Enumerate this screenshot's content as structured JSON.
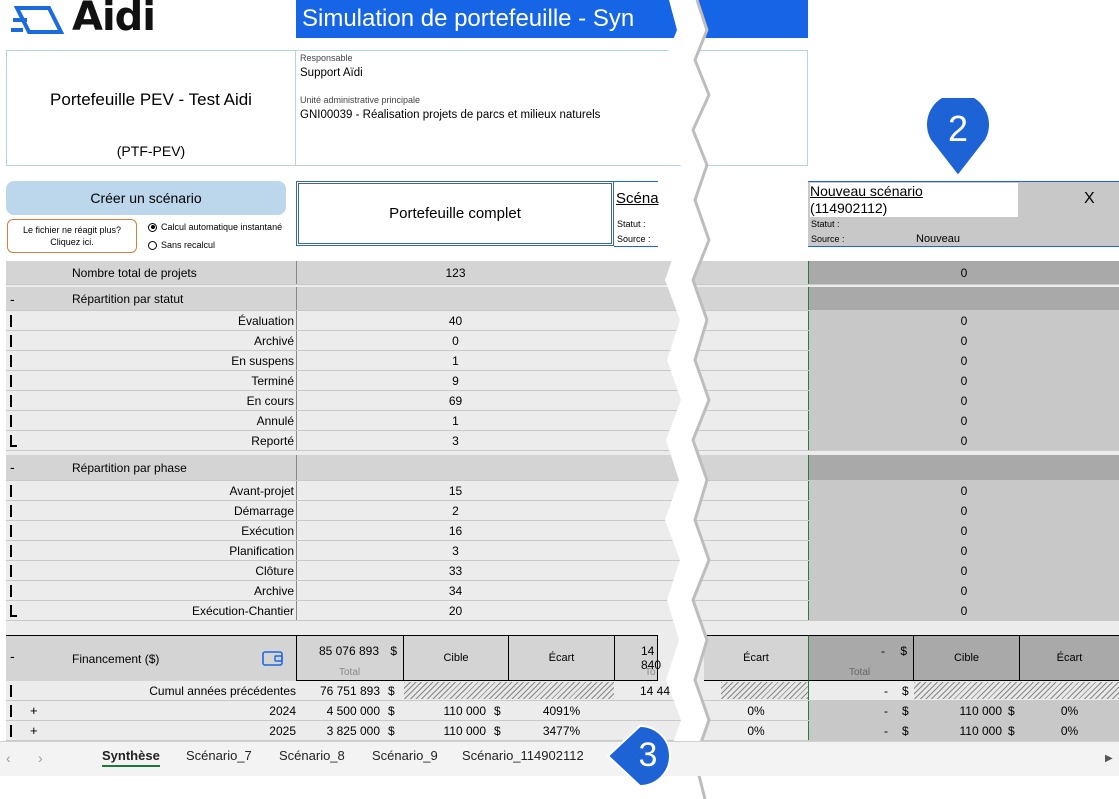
{
  "app": {
    "logo_text": "Aidi",
    "title": "Simulation de portefeuille - Syn"
  },
  "info": {
    "portfolio_name": "Portefeuille PEV - Test Aidi",
    "portfolio_code": "(PTF-PEV)",
    "responsable_label": "Responsable",
    "responsable_value": "Support Aïdi",
    "unite_label": "Unité administrative principale",
    "unite_value": "GNI00039 - Réalisation projets de parcs et milieux naturels"
  },
  "controls": {
    "create_label": "Créer un scénario",
    "freeze_line1": "Le fichier ne réagit plus?",
    "freeze_line2": "Cliquez ici.",
    "radio_auto": "Calcul automatique instantané",
    "radio_manual": "Sans recalcul",
    "portfolio_complete": "Portefeuille complet"
  },
  "scenarios": {
    "left_title": "Scéna",
    "left_statut": "Statut :",
    "left_source": "Source :",
    "new_title": "Nouveau scénario",
    "new_id": "(114902112)",
    "close_label": "X",
    "new_statut": "Statut :",
    "new_source": "Source :",
    "new_source_value": "Nouveau"
  },
  "badges": {
    "two": "2",
    "three": "3"
  },
  "grid": {
    "total": {
      "label": "Nombre total de projets",
      "v1": "123",
      "vR": "0"
    },
    "statut_header": "Répartition par statut",
    "statut_rows": [
      {
        "label": "Évaluation",
        "v1": "40",
        "vR": "0"
      },
      {
        "label": "Archivé",
        "v1": "0",
        "vR": "0"
      },
      {
        "label": "En suspens",
        "v1": "1",
        "vR": "0"
      },
      {
        "label": "Terminé",
        "v1": "9",
        "vR": "0"
      },
      {
        "label": "En cours",
        "v1": "69",
        "vR": "0"
      },
      {
        "label": "Annulé",
        "v1": "1",
        "vR": "0"
      },
      {
        "label": "Reporté",
        "v1": "3",
        "vR": "0"
      }
    ],
    "phase_header": "Répartition par phase",
    "phase_rows": [
      {
        "label": "Avant-projet",
        "v1": "15",
        "vR": "0"
      },
      {
        "label": "Démarrage",
        "v1": "2",
        "vR": "0"
      },
      {
        "label": "Exécution",
        "v1": "16",
        "vR": "0"
      },
      {
        "label": "Planification",
        "v1": "3",
        "vR": "0"
      },
      {
        "label": "Clôture",
        "v1": "33",
        "vR": "0"
      },
      {
        "label": "Archive",
        "v1": "34",
        "vR": "0"
      },
      {
        "label": "Exécution-Chantier",
        "v1": "20",
        "vR": "0"
      }
    ],
    "collapse": "-",
    "financement": {
      "label": "Financement ($)",
      "total_value": "85 076 893",
      "currency": "$",
      "total_sub": "Total",
      "cible": "Cible",
      "ecart": "Écart",
      "mid_value": "14 840",
      "mid_sub": "To",
      "mid_ecart": "Écart",
      "r_value": "-",
      "r_currency": "$",
      "r_sub": "Total",
      "r_cible": "Cible",
      "r_ecart": "Écart"
    },
    "fin_rows": [
      {
        "expand": "",
        "label": "Cumul années précédentes",
        "total": "76 751 893",
        "cur": "$",
        "cible": "",
        "cible_cur": "",
        "ecart": "",
        "mid": "14 44",
        "mid_ecart": "",
        "r_total": "-",
        "r_cur": "$",
        "r_cible": "",
        "r_cible_cur": "",
        "r_ecart": ""
      },
      {
        "expand": "+",
        "label": "2024",
        "total": "4 500 000",
        "cur": "$",
        "cible": "110 000",
        "cible_cur": "$",
        "ecart": "4091%",
        "mid": "",
        "mid_ecart": "0%",
        "r_total": "-",
        "r_cur": "$",
        "r_cible": "110 000",
        "r_cible_cur": "$",
        "r_ecart": "0%"
      },
      {
        "expand": "+",
        "label": "2025",
        "total": "3 825 000",
        "cur": "$",
        "cible": "110 000",
        "cible_cur": "$",
        "ecart": "3477%",
        "mid": "",
        "mid_ecart": "0%",
        "r_total": "-",
        "r_cur": "$",
        "r_cible": "110 000",
        "r_cible_cur": "$",
        "r_ecart": "0%"
      }
    ]
  },
  "tabs": {
    "prev_icon": "chevron-left-icon",
    "next_icon": "chevron-right-icon",
    "items": [
      "Synthèse",
      "Scénario_7",
      "Scénario_8",
      "Scénario_9",
      "Scénario_114902112"
    ]
  },
  "colors": {
    "title_bar": "#1565e6",
    "badge": "#1e63d6",
    "create_button": "#bcd7ec",
    "scenario_border": "#2a7a3a"
  }
}
